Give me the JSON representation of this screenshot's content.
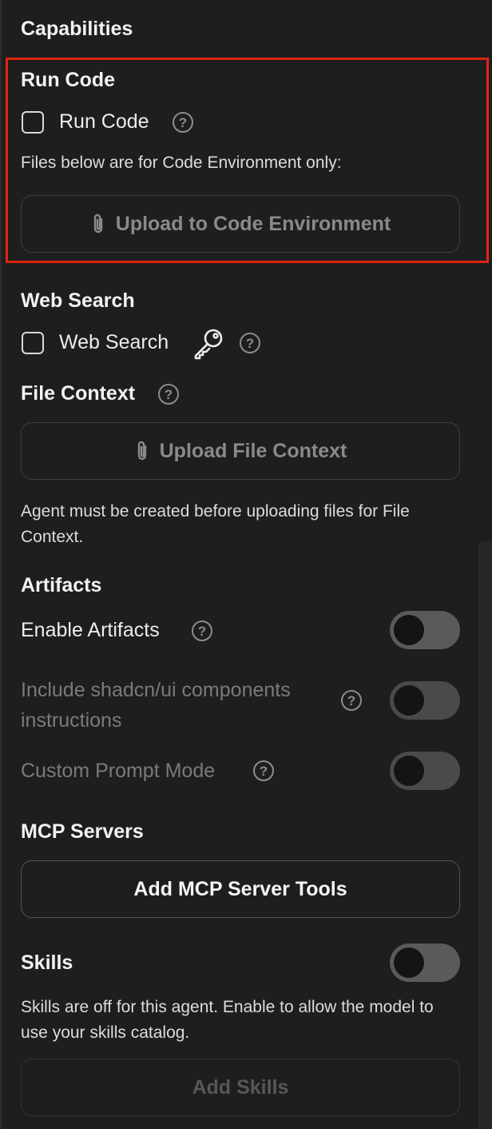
{
  "capabilities": {
    "title": "Capabilities"
  },
  "run_code": {
    "title": "Run Code",
    "checkbox_label": "Run Code",
    "note": "Files below are for Code Environment only:",
    "upload_label": "Upload to Code Environment"
  },
  "web_search": {
    "title": "Web Search",
    "checkbox_label": "Web Search"
  },
  "file_context": {
    "title": "File Context",
    "upload_label": "Upload File Context",
    "note": "Agent must be created before uploading files for File Context."
  },
  "artifacts": {
    "title": "Artifacts",
    "enable_label": "Enable Artifacts",
    "enable_on": false,
    "shadcn_label": "Include shadcn/ui components instructions",
    "shadcn_on": false,
    "custom_prompt_label": "Custom Prompt Mode",
    "custom_prompt_on": false
  },
  "mcp": {
    "title": "MCP Servers",
    "add_label": "Add MCP Server Tools"
  },
  "skills": {
    "title": "Skills",
    "enabled": false,
    "note": "Skills are off for this agent. Enable to allow the model to use your skills catalog.",
    "add_label": "Add Skills"
  },
  "icons": {
    "help": "?",
    "attach": "paperclip-icon",
    "key": "key-icon"
  },
  "colors": {
    "background": "#1e1e1e",
    "highlight": "#e0240f",
    "toggle_off": "#5a5a5a"
  }
}
